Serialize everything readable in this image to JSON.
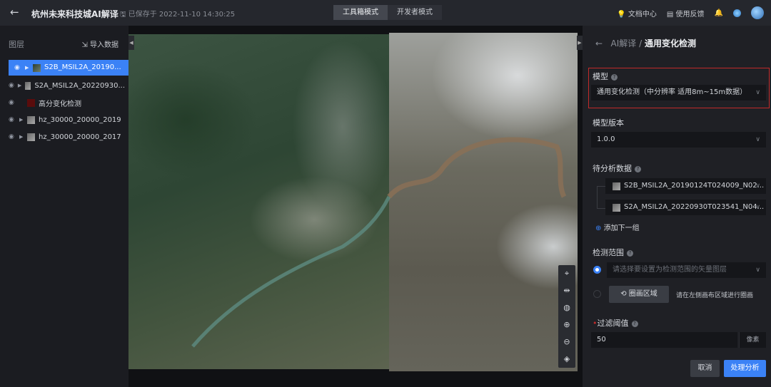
{
  "header": {
    "title": "杭州未来科技城AI解译",
    "saved": "已保存于 2022-11-10 14:30:25",
    "modes": [
      "工具箱模式",
      "开发者模式"
    ],
    "docs": "文档中心",
    "feedback": "使用反馈"
  },
  "layers": {
    "title": "图层",
    "import": "导入数据",
    "items": [
      "S2B_MSIL2A_20190...",
      "S2A_MSIL2A_20220930...",
      "高分变化检测",
      "hz_30000_20000_2019",
      "hz_30000_20000_2017"
    ]
  },
  "panel": {
    "crumb_parent": "AI解译",
    "crumb_sep": "/",
    "crumb_current": "通用变化检测",
    "model_label": "模型",
    "model_value": "通用变化检测（中分辨率 适用8m~15m数据）",
    "version_label": "模型版本",
    "version_value": "1.0.0",
    "data_label": "待分析数据",
    "data1": "S2B_MSIL2A_20190124T024009_N02...",
    "data2": "S2A_MSIL2A_20220930T023541_N04...",
    "add_group": "添加下一组",
    "range_label": "检测范围",
    "range_placeholder": "请选择要设置为检测范围的矢量图层",
    "draw_button": "圈画区域",
    "draw_hint": "请在左侧画布区域进行圈画",
    "threshold_label": "过滤阈值",
    "threshold_value": "50",
    "threshold_unit": "像素",
    "cancel": "取消",
    "submit": "处理分析"
  },
  "colors": {
    "accent": "#3b82f6",
    "highlight": "#c12a2a"
  }
}
